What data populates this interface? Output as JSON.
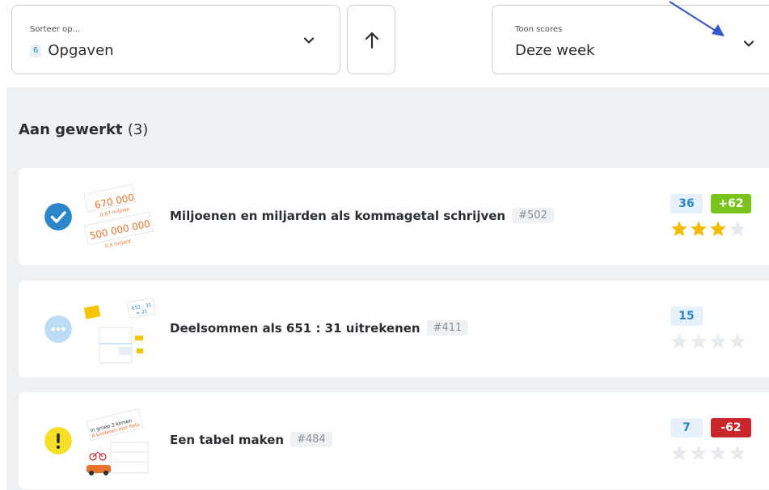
{
  "toolbar": {
    "sort": {
      "label": "Sorteer op...",
      "count": "6",
      "value": "Opgaven"
    },
    "direction": {
      "icon": "arrow-up-icon"
    },
    "scores": {
      "label": "Toon scores",
      "value": "Deze week"
    }
  },
  "section": {
    "title": "Aan gewerkt",
    "count": "(3)"
  },
  "exercises": [
    {
      "title": "Miljoenen en miljarden als kommagetal schrijven",
      "id": "#502",
      "status": "completed",
      "score": "36",
      "delta": "+62",
      "stars": 3,
      "thumb_lines": [
        "670 000",
        "0,67 miljoen",
        "500 000 000",
        "0,5 miljard"
      ]
    },
    {
      "title": "Deelsommen als 651 : 31 uitrekenen",
      "id": "#411",
      "status": "in-progress",
      "score": "15",
      "delta": "",
      "stars": 0,
      "thumb_lines": [
        "651 : 31",
        "= 21"
      ]
    },
    {
      "title": "Een tabel maken",
      "id": "#484",
      "status": "warning",
      "score": "7",
      "delta": "-62",
      "stars": 0,
      "thumb_lines": [
        "In groep 3 komen",
        "8 kinderen met fiets"
      ]
    }
  ],
  "colors": {
    "accent": "#2a86c8",
    "positive": "#7ac41b",
    "negative": "#c9262b",
    "star_on": "#f5b800",
    "star_off": "#e7eaee"
  }
}
